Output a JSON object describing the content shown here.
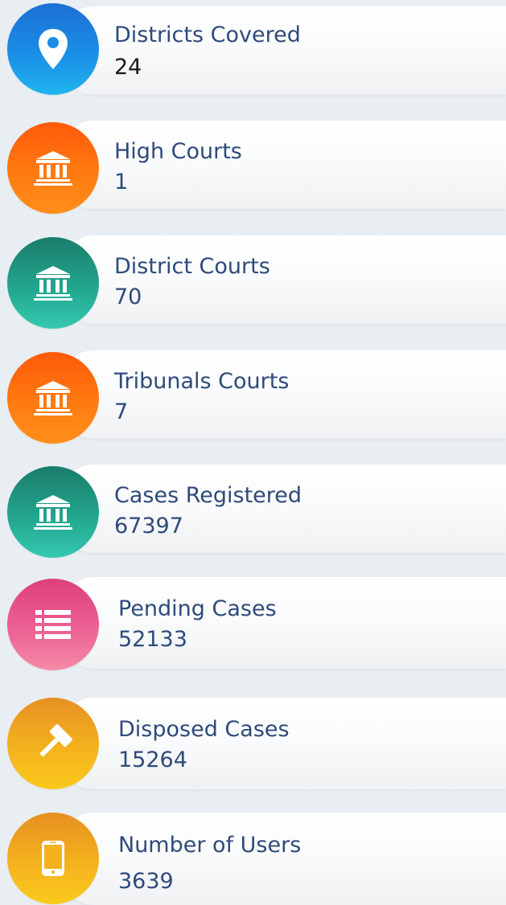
{
  "stats": [
    {
      "label": "Districts Covered",
      "value": "24",
      "icon": "map-pin-icon",
      "color": "#1a8ee6"
    },
    {
      "label": "High Courts",
      "value": "1",
      "icon": "courthouse-icon",
      "color": "#ff7a10"
    },
    {
      "label": "District Courts",
      "value": "70",
      "icon": "courthouse-icon",
      "color": "#22a58e"
    },
    {
      "label": "Tribunals Courts",
      "value": "7",
      "icon": "courthouse-icon",
      "color": "#ff7a10"
    },
    {
      "label": "Cases Registered",
      "value": "67397",
      "icon": "courthouse-icon",
      "color": "#22a58e"
    },
    {
      "label": "Pending Cases",
      "value": "52133",
      "icon": "list-icon",
      "color": "#ec6193"
    },
    {
      "label": "Disposed Cases",
      "value": "15264",
      "icon": "gavel-icon",
      "color": "#f4b21e"
    },
    {
      "label": "Number of Users",
      "value": "3639",
      "icon": "mobile-phone-icon",
      "color": "#f4b21e"
    }
  ]
}
